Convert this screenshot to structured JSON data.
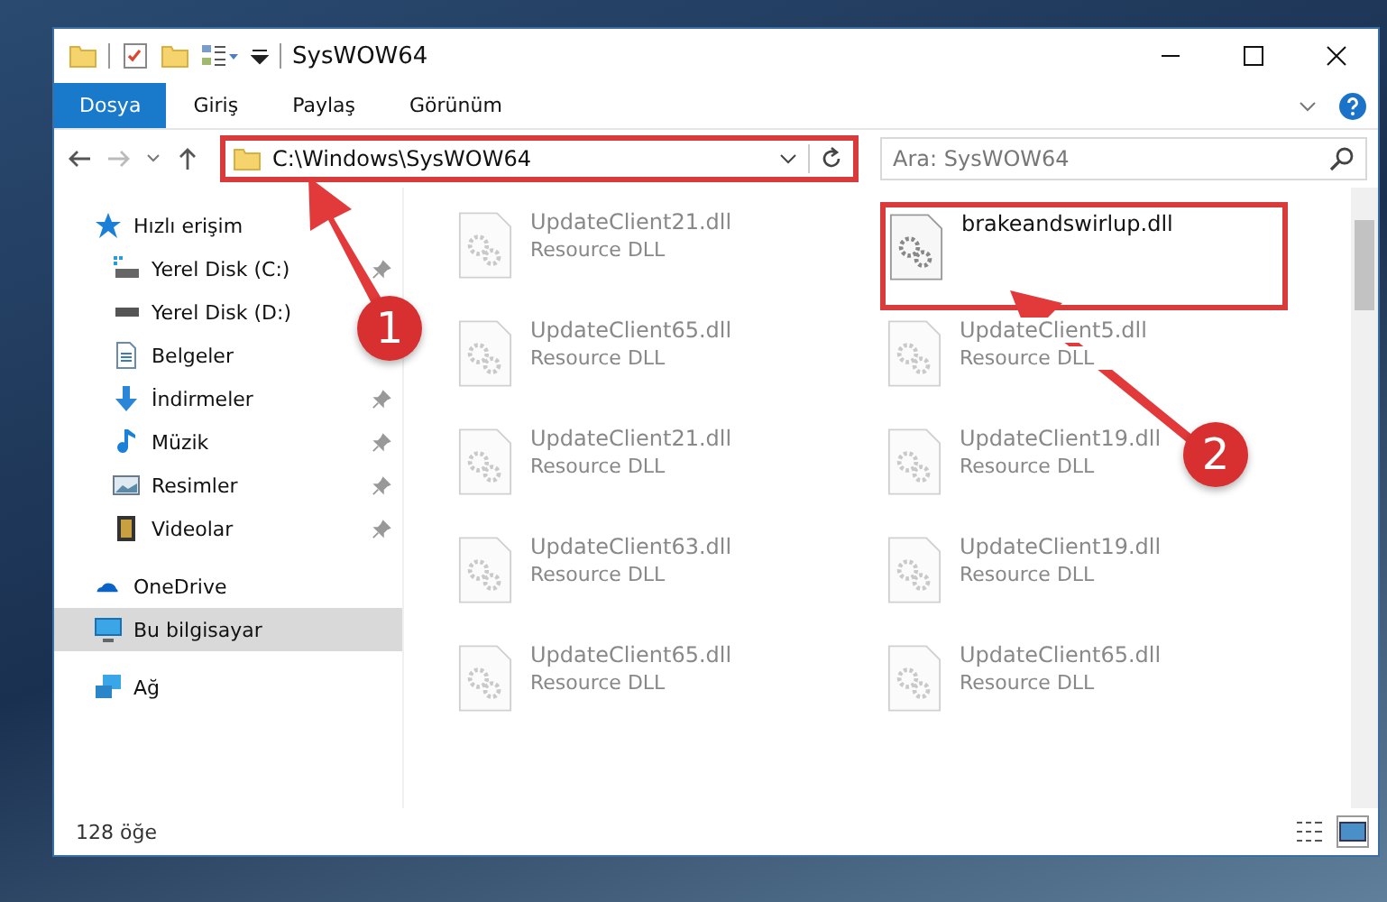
{
  "window": {
    "title": "SysWOW64"
  },
  "ribbon_tabs": [
    {
      "label": "Dosya",
      "selected": true
    },
    {
      "label": "Giriş",
      "selected": false
    },
    {
      "label": "Paylaş",
      "selected": false
    },
    {
      "label": "Görünüm",
      "selected": false
    }
  ],
  "address": {
    "path": "C:\\Windows\\SysWOW64",
    "highlighted": true
  },
  "search": {
    "placeholder": "Ara: SysWOW64"
  },
  "sidebar": {
    "items": [
      {
        "label": "Hızlı erişim",
        "kind": "star",
        "selected": false,
        "children": [
          {
            "label": "Yerel Disk (C:)",
            "kind": "windrive",
            "pinned": true
          },
          {
            "label": "Yerel Disk (D:)",
            "kind": "drive",
            "pinned": false
          },
          {
            "label": "Belgeler",
            "kind": "documents",
            "pinned": false
          },
          {
            "label": "İndirmeler",
            "kind": "download",
            "pinned": true
          },
          {
            "label": "Müzik",
            "kind": "music",
            "pinned": true
          },
          {
            "label": "Resimler",
            "kind": "pictures",
            "pinned": true
          },
          {
            "label": "Videolar",
            "kind": "videos",
            "pinned": true
          }
        ]
      },
      {
        "label": "OneDrive",
        "kind": "cloud",
        "selected": false
      },
      {
        "label": "Bu bilgisayar",
        "kind": "computer",
        "selected": true
      },
      {
        "label": "Ağ",
        "kind": "network",
        "selected": false
      }
    ]
  },
  "files": [
    {
      "name": "UpdateClient21.dll",
      "type": "Resource DLL",
      "blurred": true,
      "highlighted": false
    },
    {
      "name": "brakeandswirlup.dll",
      "blurred": false,
      "highlighted": true
    },
    {
      "name": "UpdateClient65.dll",
      "type": "Resource DLL",
      "blurred": true,
      "highlighted": false
    },
    {
      "name": "UpdateClient5.dll",
      "type": "Resource DLL",
      "blurred": true,
      "highlighted": false
    },
    {
      "name": "UpdateClient21.dll",
      "type": "Resource DLL",
      "blurred": true,
      "highlighted": false
    },
    {
      "name": "UpdateClient19.dll",
      "type": "Resource DLL",
      "blurred": true,
      "highlighted": false
    },
    {
      "name": "UpdateClient63.dll",
      "type": "Resource DLL",
      "blurred": true,
      "highlighted": false
    },
    {
      "name": "UpdateClient19.dll",
      "type": "Resource DLL",
      "blurred": true,
      "highlighted": false
    },
    {
      "name": "UpdateClient65.dll",
      "type": "Resource DLL",
      "blurred": true,
      "highlighted": false
    },
    {
      "name": "UpdateClient65.dll",
      "type": "Resource DLL",
      "blurred": true,
      "highlighted": false
    }
  ],
  "status_bar": {
    "count": "128 öğe"
  },
  "annotations": [
    {
      "label": "1"
    },
    {
      "label": "2"
    }
  ]
}
